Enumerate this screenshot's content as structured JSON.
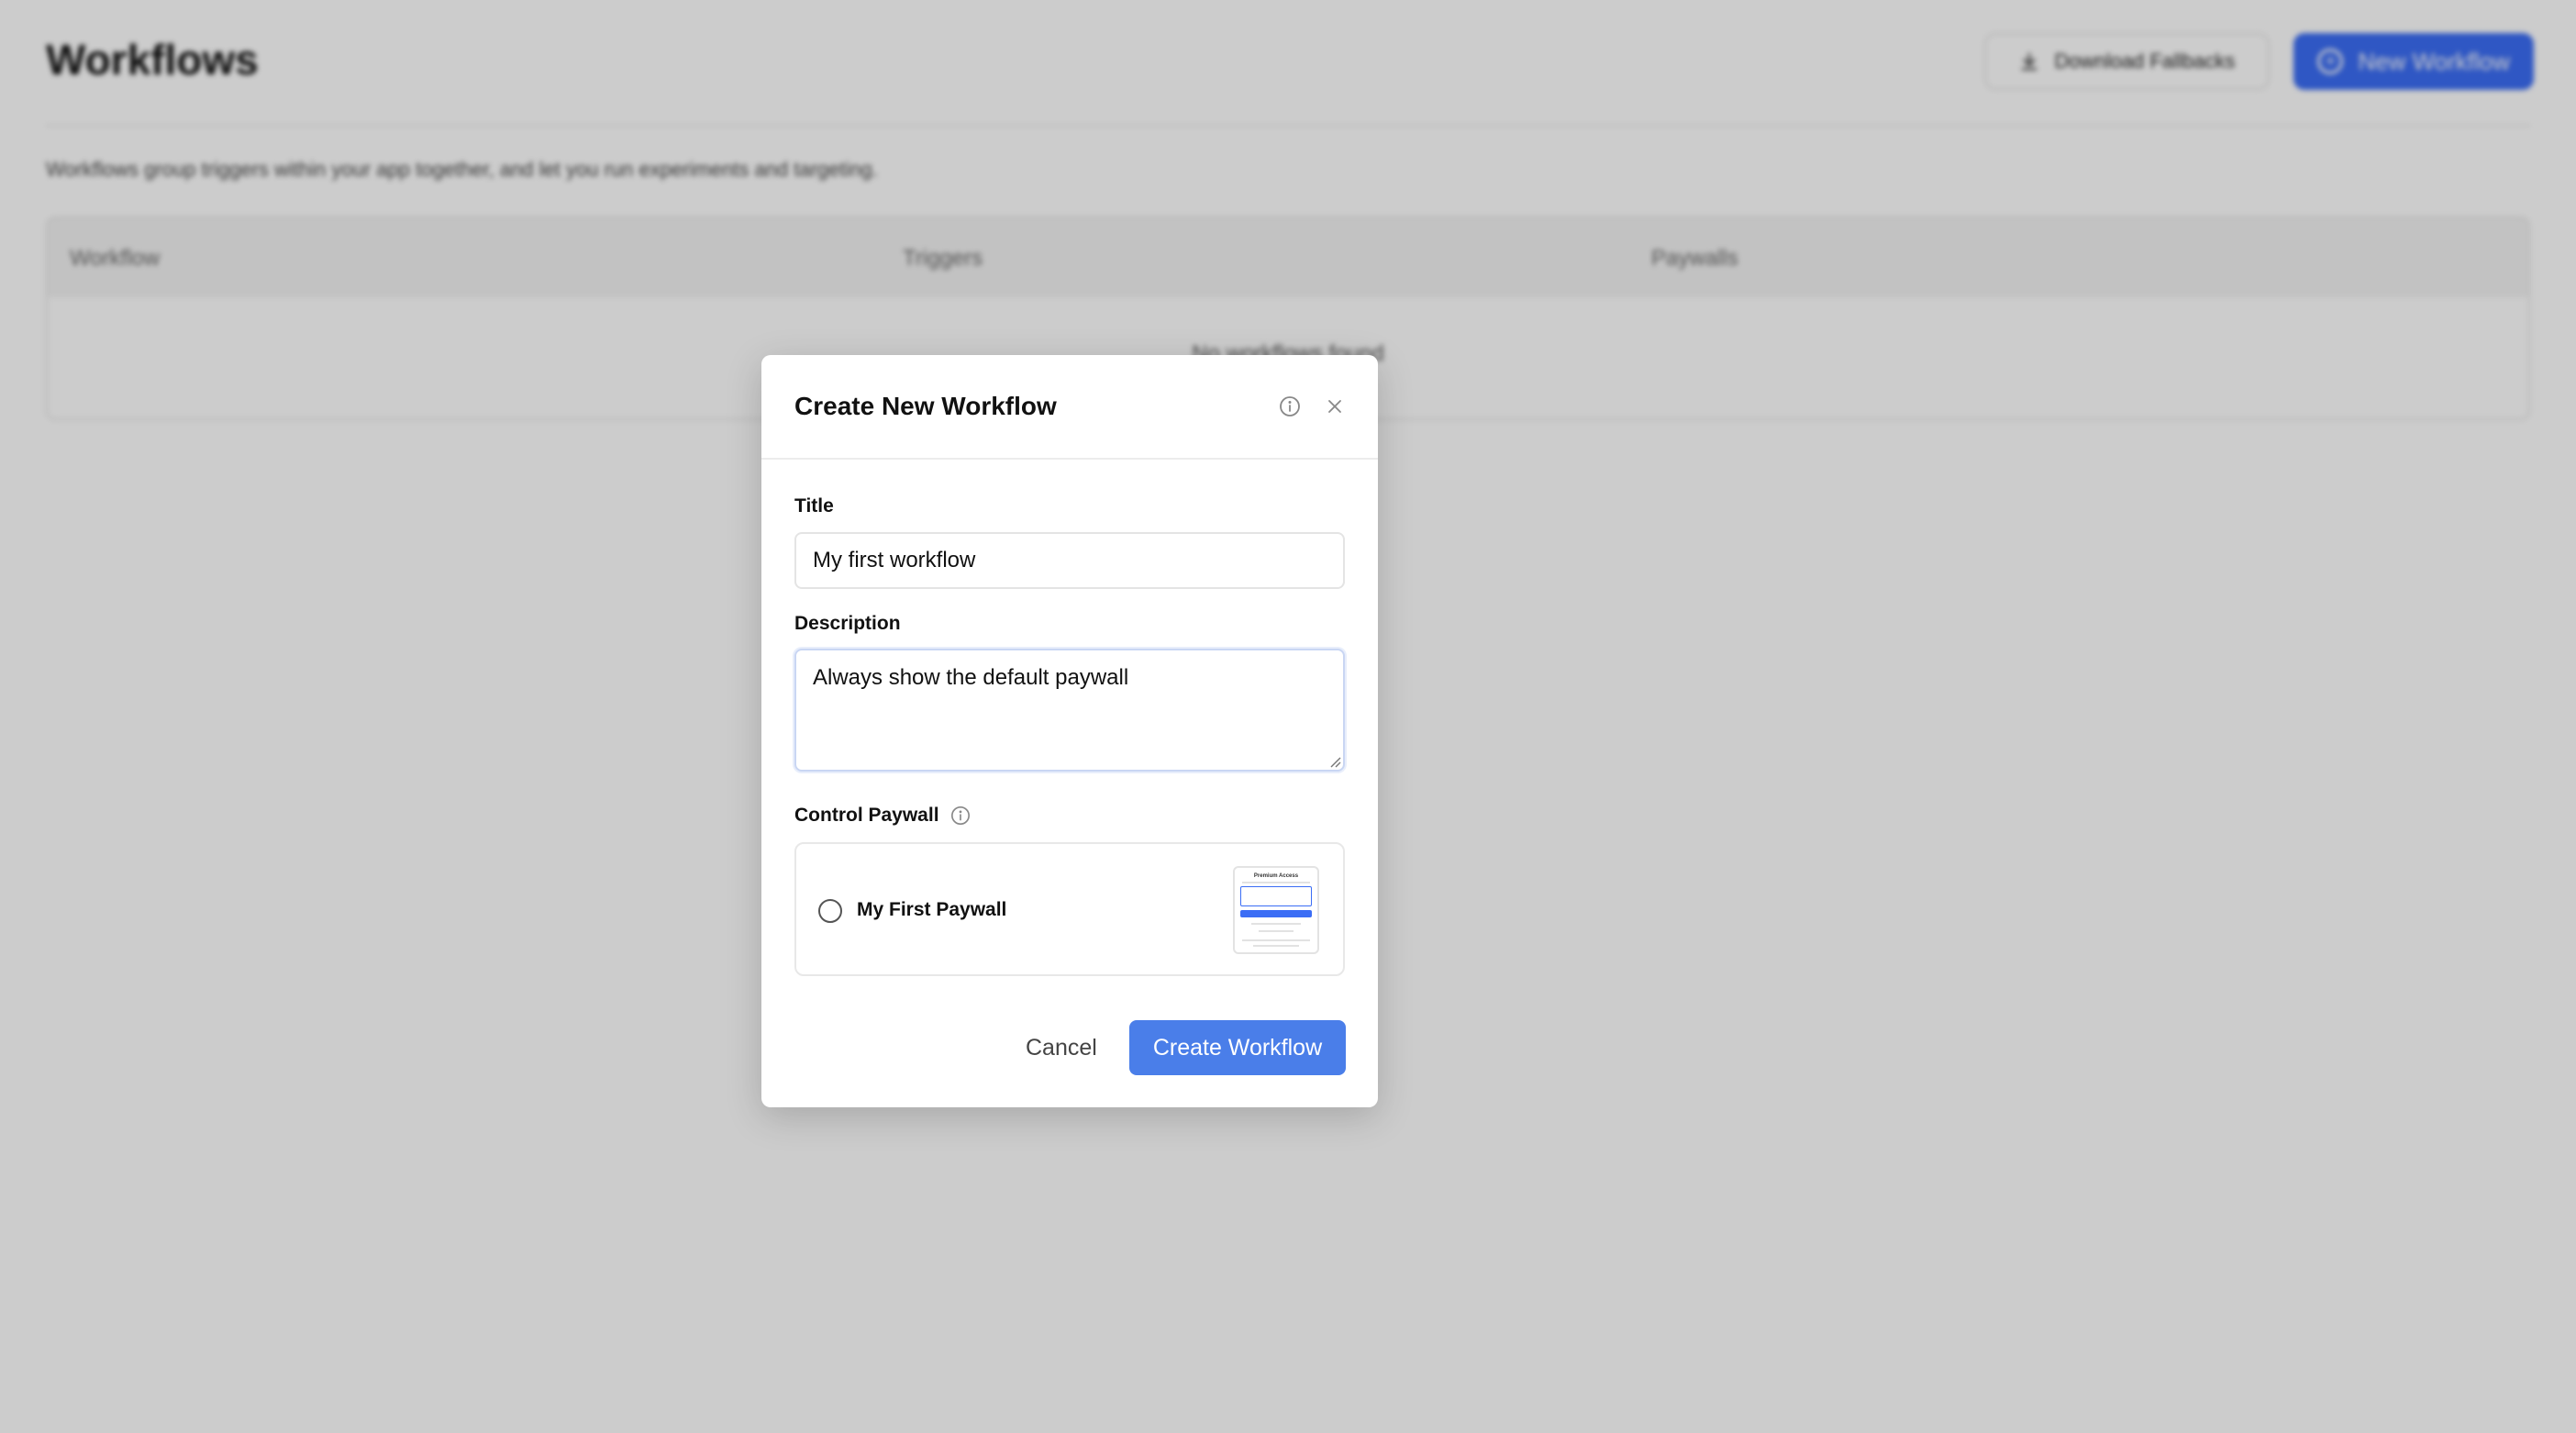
{
  "page": {
    "title": "Workflows",
    "download_button": "Download Fallbacks",
    "new_button": "New Workflow",
    "description": "Workflows group triggers within your app together, and let you run experiments and targeting.",
    "table": {
      "columns": [
        "Workflow",
        "Triggers",
        "Paywalls"
      ],
      "empty_text": "No workflows found"
    }
  },
  "modal": {
    "title": "Create New Workflow",
    "title_label": "Title",
    "title_value": "My first workflow",
    "description_label": "Description",
    "description_value": "Always show the default paywall",
    "control_paywall_label": "Control Paywall",
    "paywall_option": {
      "name": "My First Paywall",
      "selected": false,
      "thumbnail_title": "Premium Access"
    },
    "cancel_label": "Cancel",
    "create_label": "Create Workflow"
  },
  "colors": {
    "accent": "#4a7ee9",
    "accent_bg_button": "#3b6df5"
  },
  "icons": {
    "download": "download-icon",
    "plus": "plus-circle-icon",
    "info": "info-icon",
    "close": "close-icon"
  }
}
